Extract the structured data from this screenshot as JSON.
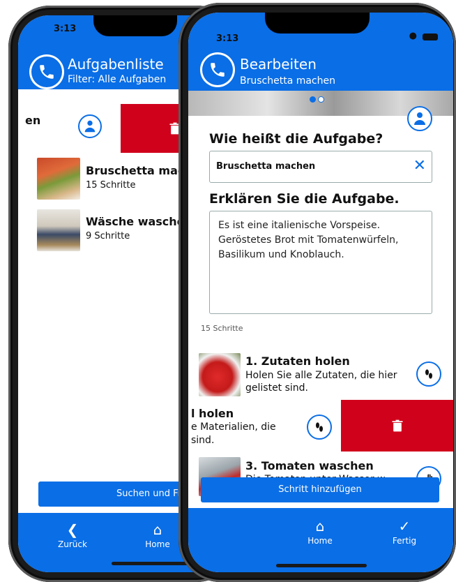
{
  "left_screen": {
    "status_time": "3:13",
    "header_title": "Aufgabenliste",
    "header_subtitle": "Filter: Alle Aufgaben",
    "swiped_row_fragment": "en",
    "tasks": [
      {
        "title": "Bruschetta machen",
        "steps": "15 Schritte"
      },
      {
        "title": "Wäsche waschen",
        "steps": "9 Schritte"
      }
    ],
    "search_filter_button": "Suchen und Filter",
    "tabs": {
      "back": "Zurück",
      "home": "Home"
    }
  },
  "right_screen": {
    "status_time": "3:13",
    "header_title": "Bearbeiten",
    "header_subtitle": "Bruschetta machen",
    "question_name": "Wie heißt die Aufgabe?",
    "name_value": "Bruschetta machen",
    "question_explain": "Erklären Sie die Aufgabe.",
    "explain_value": "Es ist eine italienische Vorspeise. Geröstetes Brot mit Tomatenwürfeln, Basilikum und Knoblauch.",
    "steps_count": "15 Schritte",
    "steps": [
      {
        "title": "1. Zutaten holen",
        "desc": "Holen Sie alle Zutaten, die hier gelistet sind."
      },
      {
        "title_fragment": "l holen",
        "desc_line1": "e Materialien, die",
        "desc_line2": "sind."
      },
      {
        "title": "3. Tomaten waschen",
        "desc": "Die Tomaten unter Wasser w"
      }
    ],
    "add_step_button": "Schritt hinzufügen",
    "tabs": {
      "home": "Home",
      "done": "Fertig"
    }
  },
  "colors": {
    "accent": "#0a6ee6",
    "delete": "#d0021b"
  }
}
